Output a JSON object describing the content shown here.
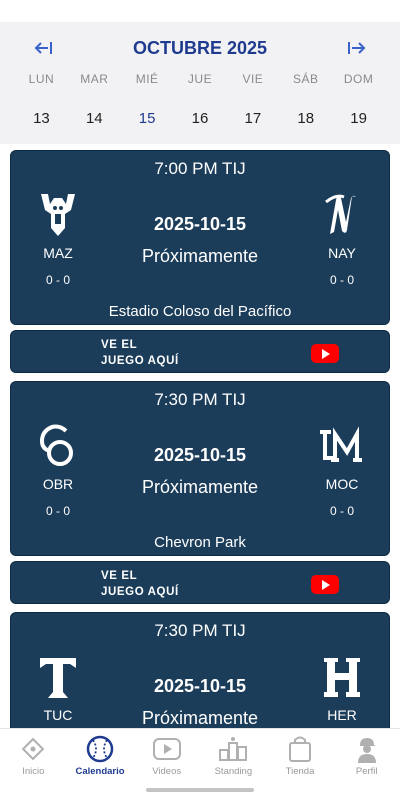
{
  "calendar": {
    "month_title": "OCTUBRE 2025",
    "days": [
      {
        "name": "LUN",
        "num": "13"
      },
      {
        "name": "MAR",
        "num": "14"
      },
      {
        "name": "MIÉ",
        "num": "15"
      },
      {
        "name": "JUE",
        "num": "16"
      },
      {
        "name": "VIE",
        "num": "17"
      },
      {
        "name": "SÁB",
        "num": "18"
      },
      {
        "name": "DOM",
        "num": "19"
      }
    ],
    "selected_day": "15",
    "accent_color": "#1f3b8f"
  },
  "games": [
    {
      "time": "7:00 PM TIJ",
      "date": "2025-10-15",
      "status": "Próximamente",
      "venue": "Estadio Coloso del Pacífico",
      "away": {
        "abbr": "MAZ",
        "record": "0 - 0",
        "logo": "mazatlan-deer-logo"
      },
      "home": {
        "abbr": "NAY",
        "record": "0 - 0",
        "logo": "nayarit-n-logo"
      }
    },
    {
      "time": "7:30 PM TIJ",
      "date": "2025-10-15",
      "status": "Próximamente",
      "venue": "Chevron Park",
      "away": {
        "abbr": "OBR",
        "record": "0 - 0",
        "logo": "obregon-co-logo"
      },
      "home": {
        "abbr": "MOC",
        "record": "0 - 0",
        "logo": "mochis-lm-logo"
      }
    },
    {
      "time": "7:30 PM TIJ",
      "date": "2025-10-15",
      "status": "Próximamente",
      "venue": "",
      "away": {
        "abbr": "TUC",
        "record": "",
        "logo": "tucson-t-logo"
      },
      "home": {
        "abbr": "HER",
        "record": "",
        "logo": "hermosillo-h-logo"
      }
    }
  ],
  "watch": {
    "line1": "VE EL",
    "line2": "JUEGO AQUÍ",
    "icon": "youtube-icon"
  },
  "nav": {
    "items": [
      {
        "label": "Inicio",
        "icon": "baseball-diamond-icon"
      },
      {
        "label": "Calendario",
        "icon": "baseball-icon"
      },
      {
        "label": "Videos",
        "icon": "play-icon"
      },
      {
        "label": "Standing",
        "icon": "podium-icon"
      },
      {
        "label": "Tienda",
        "icon": "shopping-bag-icon"
      },
      {
        "label": "Perfil",
        "icon": "player-icon"
      }
    ],
    "active": "Calendario"
  },
  "colors": {
    "card": "#1c3d5a",
    "youtube": "#ff0000",
    "inactive": "#9a9a9a"
  }
}
